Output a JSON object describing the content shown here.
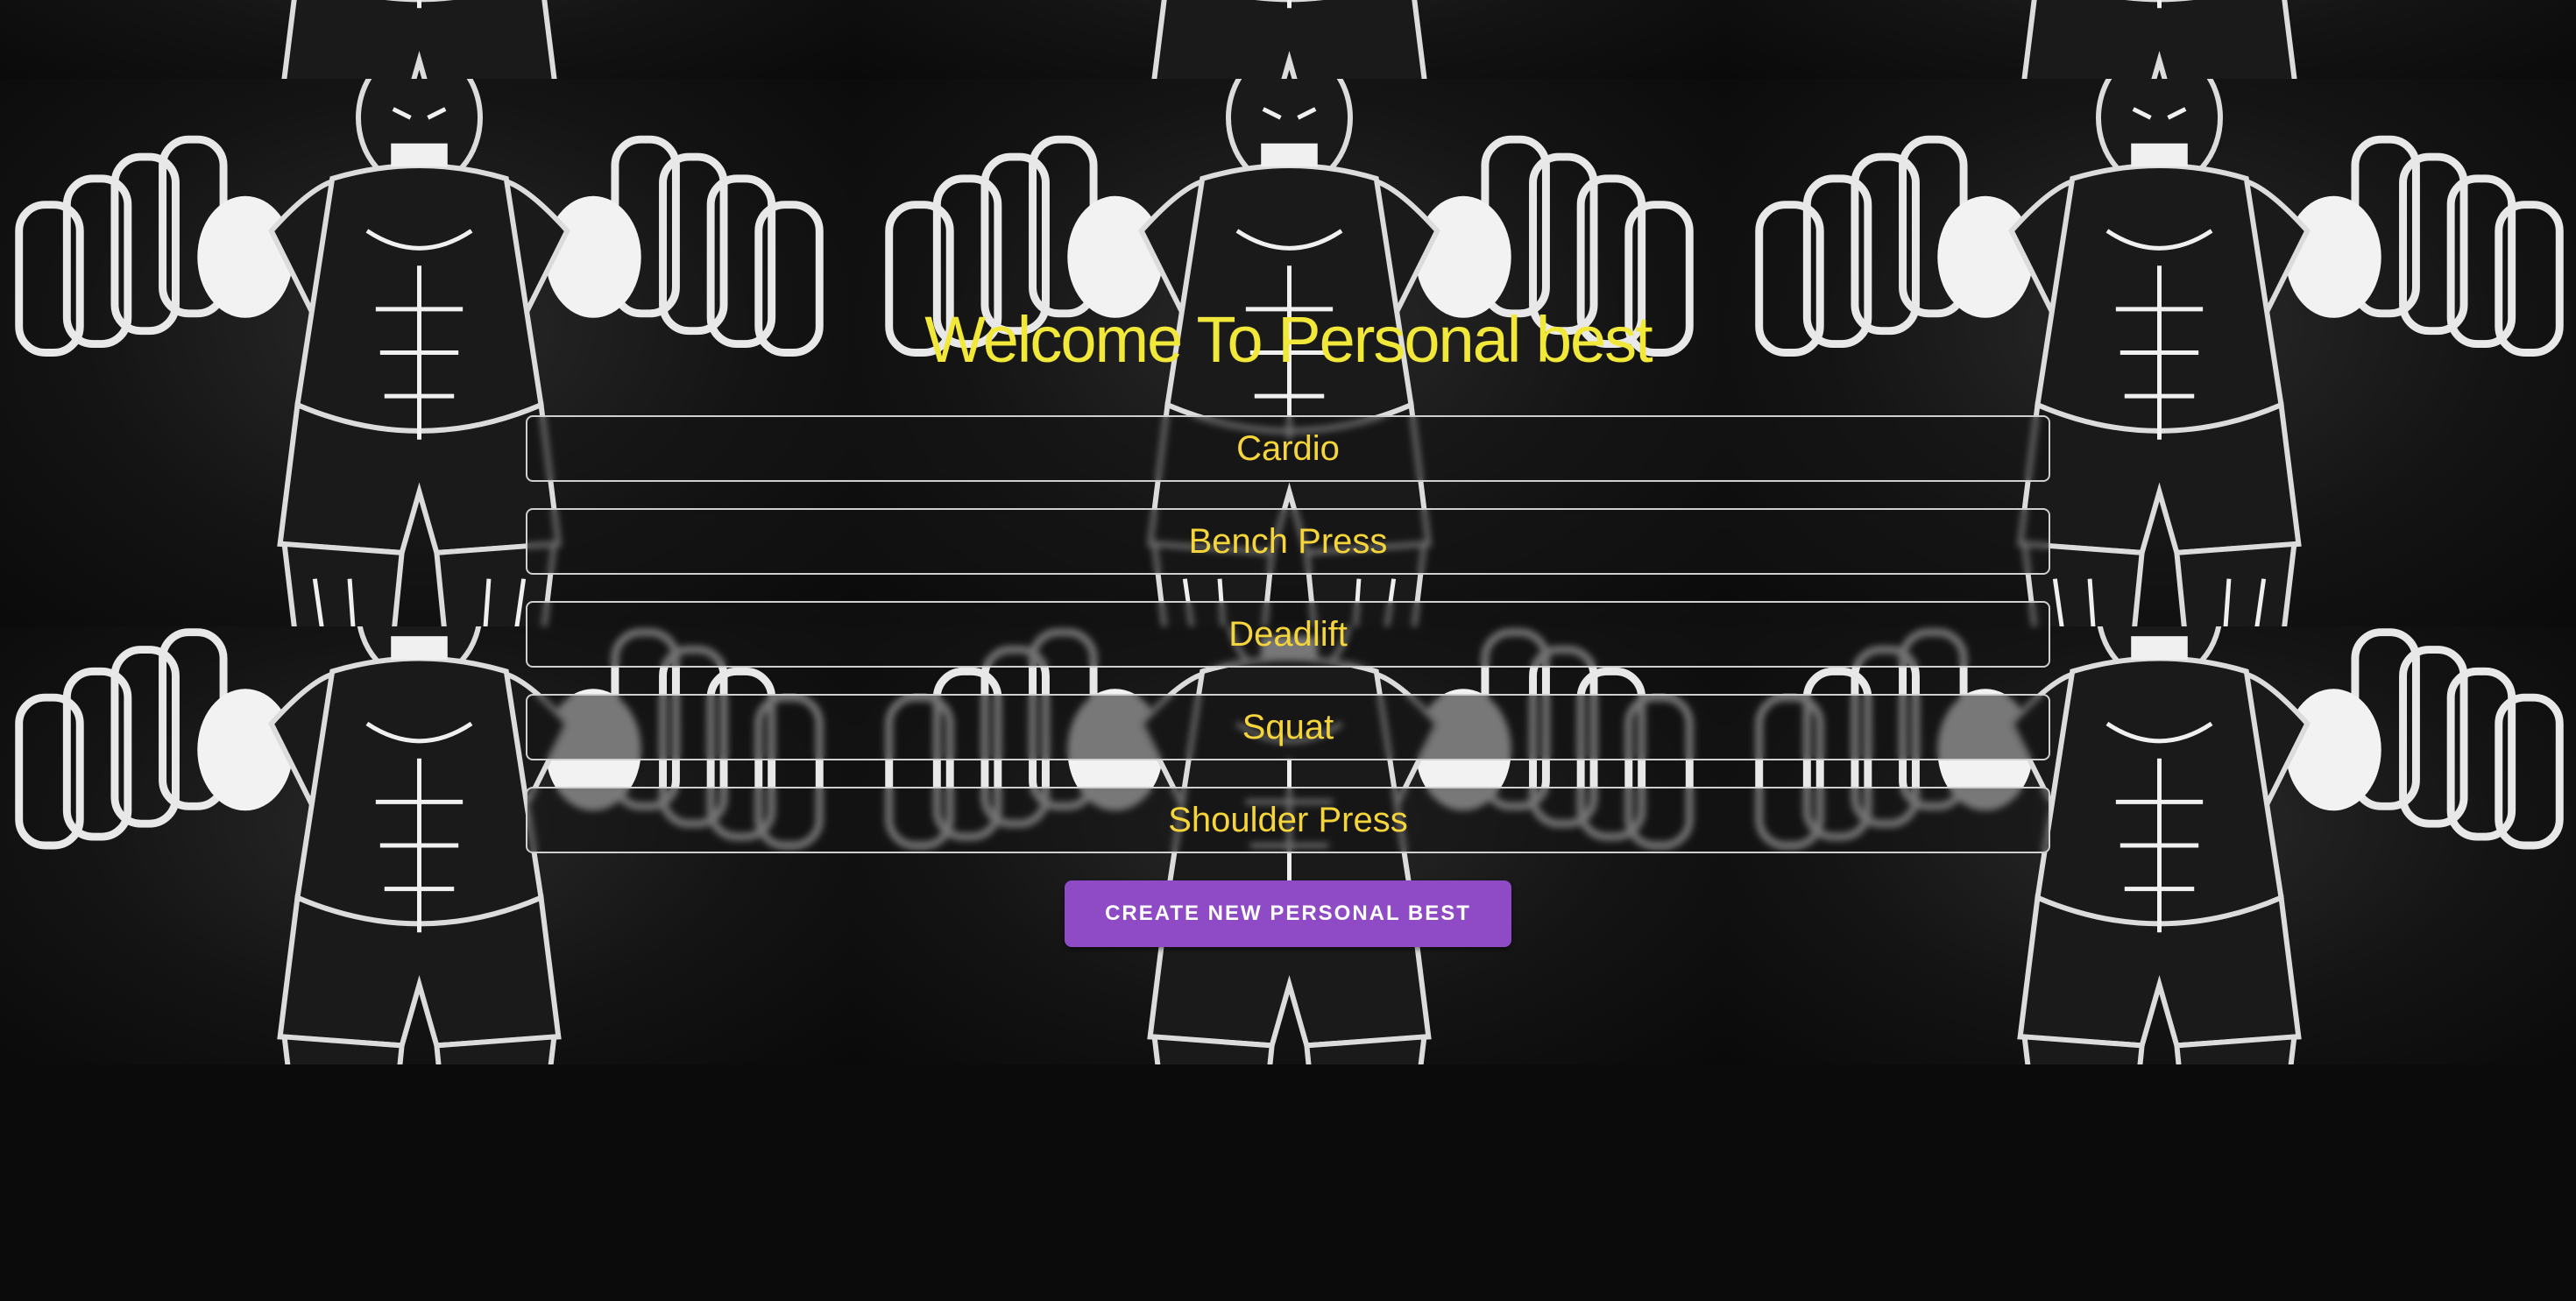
{
  "page": {
    "title": "Welcome To Personal best"
  },
  "exercises": [
    {
      "label": "Cardio"
    },
    {
      "label": "Bench Press"
    },
    {
      "label": "Deadlift"
    },
    {
      "label": "Squat"
    },
    {
      "label": "Shoulder Press"
    }
  ],
  "actions": {
    "create_label": "CREATE NEW PERSONAL BEST"
  },
  "colors": {
    "title": "#f1e83a",
    "item_text": "#f6d53b",
    "item_border": "#cfcfcf",
    "button_bg": "#8e4bc5",
    "button_text": "#ffffff",
    "background": "#0b0b0b"
  },
  "background_image": {
    "icon": "muscular-weightlifter-illustration"
  }
}
